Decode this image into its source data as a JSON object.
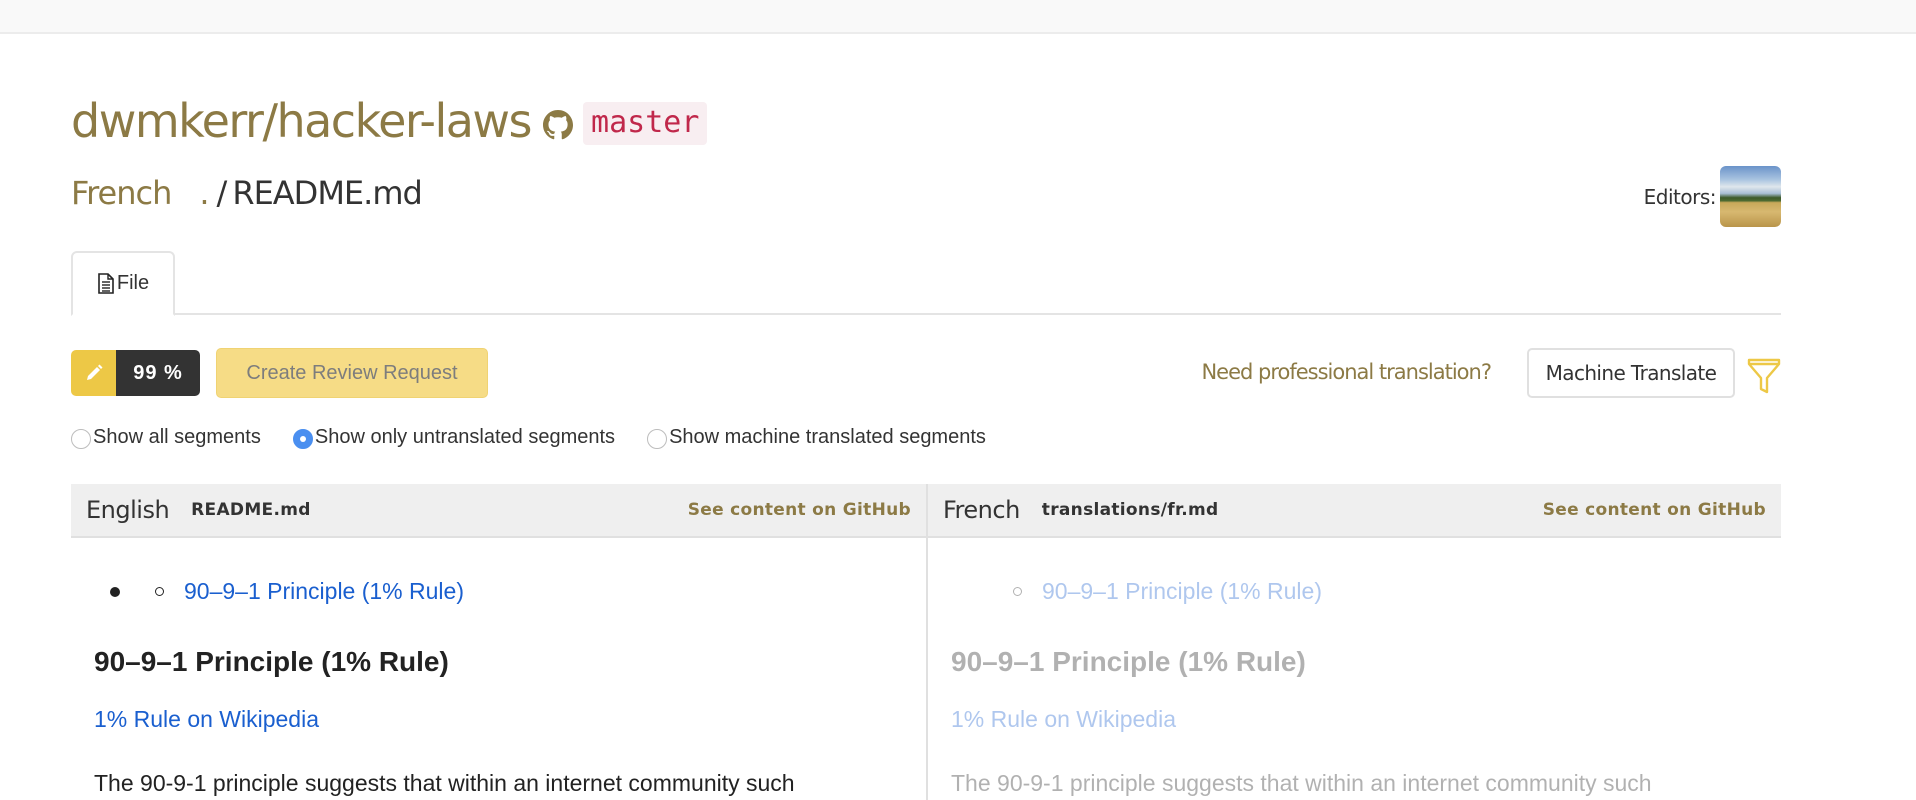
{
  "header": {
    "repo_title": "dwmkerr/hacker-laws",
    "branch": "master",
    "language": "French",
    "path_dot": ".",
    "path_separator": "/",
    "filename": "README.md",
    "editors_label": "Editors:"
  },
  "tabs": [
    {
      "label": "File",
      "icon": "file-icon",
      "active": true
    }
  ],
  "toolbar": {
    "progress_percent": 99,
    "progress_label": "99 %",
    "review_button": "Create Review Request",
    "pro_translation_link": "Need professional translation?",
    "machine_translate_button": "Machine Translate"
  },
  "filters": {
    "options": [
      {
        "label": "Show all segments",
        "checked": false
      },
      {
        "label": "Show only untranslated segments",
        "checked": true
      },
      {
        "label": "Show machine translated segments",
        "checked": false
      }
    ]
  },
  "source_pane": {
    "language": "English",
    "file": "README.md",
    "github_link": "See content on GitHub",
    "bullet_link": "90–9–1 Principle (1% Rule)",
    "heading": "90–9–1 Principle (1% Rule)",
    "wiki_link": "1% Rule on Wikipedia",
    "paragraph": "The 90-9-1 principle suggests that within an internet community such"
  },
  "target_pane": {
    "language": "French",
    "file": "translations/fr.md",
    "github_link": "See content on GitHub",
    "bullet_link": "90–9–1 Principle (1% Rule)",
    "heading": "90–9–1 Principle (1% Rule)",
    "wiki_link": "1% Rule on Wikipedia",
    "paragraph": "The 90-9-1 principle suggests that within an internet community such"
  },
  "colors": {
    "brand_gold": "#8c7a45",
    "accent_yellow": "#edc846",
    "link_blue": "#1a5fcf",
    "branch_red": "#c0284b"
  }
}
